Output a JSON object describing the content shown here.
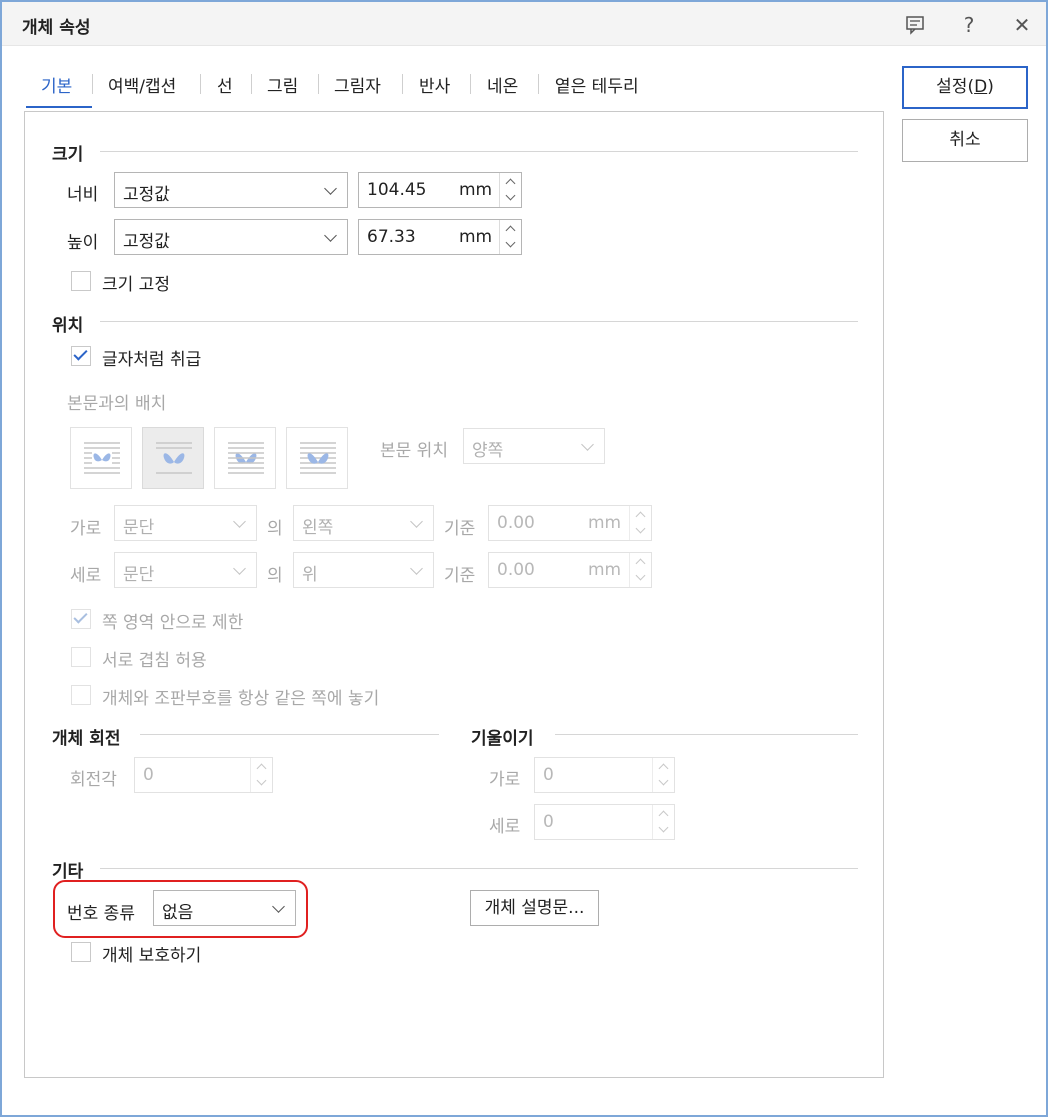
{
  "window": {
    "title": "개체 속성"
  },
  "titlebar_icons": [
    "comment-icon",
    "help-icon",
    "close-icon"
  ],
  "titlebar": {
    "help_glyph": "?",
    "close_glyph": "✕"
  },
  "tabs": [
    "기본",
    "여백/캡션",
    "선",
    "그림",
    "그림자",
    "반사",
    "네온",
    "옅은 테두리"
  ],
  "active_tab": "기본",
  "buttons": {
    "ok_text": "설정(",
    "ok_key": "D",
    "ok_close": ")",
    "cancel": "취소"
  },
  "size": {
    "heading": "크기",
    "width_label": "너비",
    "width_mode": "고정값",
    "width_value": "104.45",
    "width_unit": "mm",
    "height_label": "높이",
    "height_mode": "고정값",
    "height_value": "67.33",
    "height_unit": "mm",
    "fix_size_label": "크기 고정",
    "fix_size_checked": false
  },
  "position": {
    "heading": "위치",
    "treat_as_char_label": "글자처럼 취급",
    "treat_as_char_checked": true,
    "wrap_label": "본문과의 배치",
    "wrap_selected_index": 1,
    "body_pos_label": "본문 위치",
    "body_pos_value": "양쪽",
    "horizontal_label": "가로",
    "horizontal_ref": "문단",
    "of_label": "의",
    "horizontal_align": "왼쪽",
    "base_label": "기준",
    "horizontal_offset": "0.00",
    "offset_unit": "mm",
    "vertical_label": "세로",
    "vertical_ref": "문단",
    "vertical_align": "위",
    "vertical_offset": "0.00",
    "limit_page_label": "쪽 영역 안으로 제한",
    "limit_page_checked": true,
    "allow_overlap_label": "서로 겹침 허용",
    "allow_overlap_checked": false,
    "same_page_label": "개체와 조판부호를 항상 같은 쪽에 놓기",
    "same_page_checked": false
  },
  "rotation": {
    "heading": "개체 회전",
    "angle_label": "회전각",
    "angle_value": "0"
  },
  "skew": {
    "heading": "기울이기",
    "horizontal_label": "가로",
    "horizontal_value": "0",
    "vertical_label": "세로",
    "vertical_value": "0"
  },
  "etc": {
    "heading": "기타",
    "numbering_label": "번호 종류",
    "numbering_value": "없음",
    "description_button": "개체 설명문...",
    "protect_label": "개체 보호하기",
    "protect_checked": false
  },
  "colors": {
    "accent": "#2b64c8",
    "highlight": "#e02020",
    "disabled_text": "#a8a8a8"
  }
}
